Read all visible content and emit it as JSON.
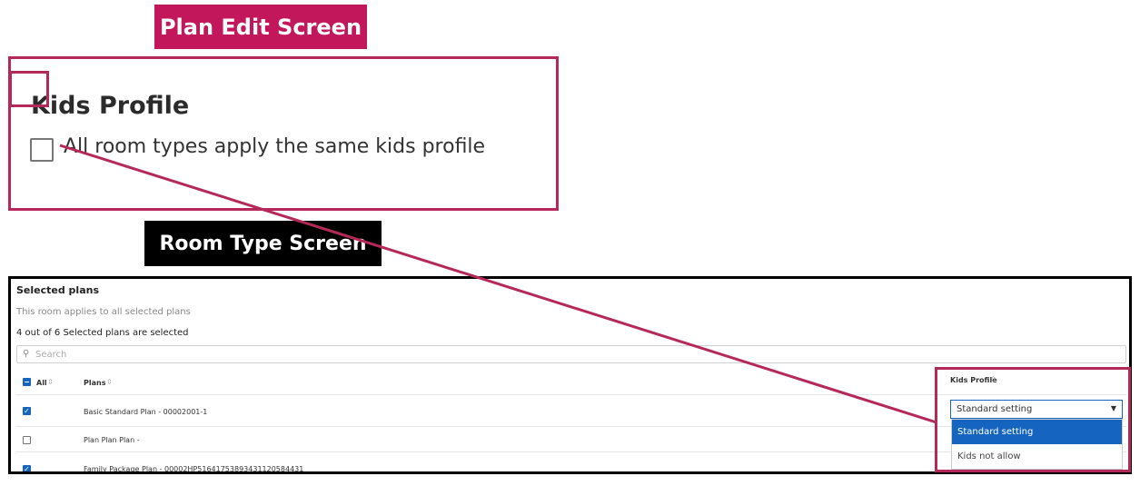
{
  "labels": {
    "plan_edit": "Plan Edit Screen",
    "room_type": "Room Type Screen"
  },
  "plan_edit": {
    "title": "Kids Profile",
    "checkbox_label": "All room types apply the same kids profile",
    "checkbox_checked": false
  },
  "room_type": {
    "section_title": "Selected plans",
    "subtitle": "This room applies to all selected plans",
    "count_text": "4 out of 6 Selected plans are selected",
    "search": {
      "placeholder": "Search",
      "icon": "search-icon"
    },
    "columns": {
      "all": "All",
      "plans": "Plans",
      "kids_profile": "Kids Profile"
    },
    "rows": [
      {
        "checked": true,
        "plan": "Basic Standard Plan - 00002001-1"
      },
      {
        "checked": false,
        "plan": "Plan Plan Plan -"
      },
      {
        "checked": true,
        "plan": "Family Package Plan - 00002HP51641753893431120584431"
      }
    ],
    "kids_profile_select": {
      "value": "Standard setting",
      "options": [
        "Standard setting",
        "Kids not allow"
      ]
    }
  },
  "colors": {
    "accent": "#c2185b",
    "highlight": "#b5295a",
    "primary": "#1565c0"
  }
}
